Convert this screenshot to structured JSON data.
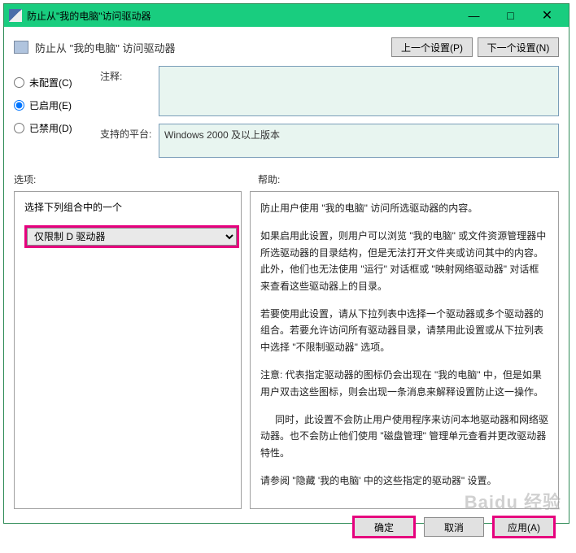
{
  "titlebar": {
    "title": "防止从\"我的电脑\"访问驱动器",
    "minimize": "—",
    "maximize": "□",
    "close": "✕"
  },
  "header": {
    "text": "防止从 \"我的电脑\" 访问驱动器",
    "prev_btn": "上一个设置(P)",
    "next_btn": "下一个设置(N)"
  },
  "radios": {
    "not_configured": "未配置(C)",
    "enabled": "已启用(E)",
    "disabled": "已禁用(D)"
  },
  "labels": {
    "annotation": "注释:",
    "platform": "支持的平台:",
    "options": "选项:",
    "help": "帮助:"
  },
  "platform_text": "Windows 2000 及以上版本",
  "options_panel": {
    "choose_label": "选择下列组合中的一个",
    "selected": "仅限制 D 驱动器"
  },
  "help_paragraphs": [
    "防止用户使用 \"我的电脑\" 访问所选驱动器的内容。",
    "如果启用此设置，则用户可以浏览 \"我的电脑\" 或文件资源管理器中所选驱动器的目录结构，但是无法打开文件夹或访问其中的内容。此外，他们也无法使用 \"运行\" 对话框或 \"映射网络驱动器\" 对话框来查看这些驱动器上的目录。",
    "若要使用此设置，请从下拉列表中选择一个驱动器或多个驱动器的组合。若要允许访问所有驱动器目录，请禁用此设置或从下拉列表中选择 \"不限制驱动器\" 选项。",
    "注意: 代表指定驱动器的图标仍会出现在 \"我的电脑\" 中，但是如果用户双击这些图标，则会出现一条消息来解释设置防止这一操作。",
    "同时，此设置不会防止用户使用程序来访问本地驱动器和网络驱动器。也不会防止他们使用 \"磁盘管理\" 管理单元查看并更改驱动器特性。",
    "请参阅 \"隐藏 '我的电脑' 中的这些指定的驱动器\" 设置。"
  ],
  "footer": {
    "ok": "确定",
    "cancel": "取消",
    "apply": "应用(A)"
  },
  "watermark": "Baidu 经验"
}
